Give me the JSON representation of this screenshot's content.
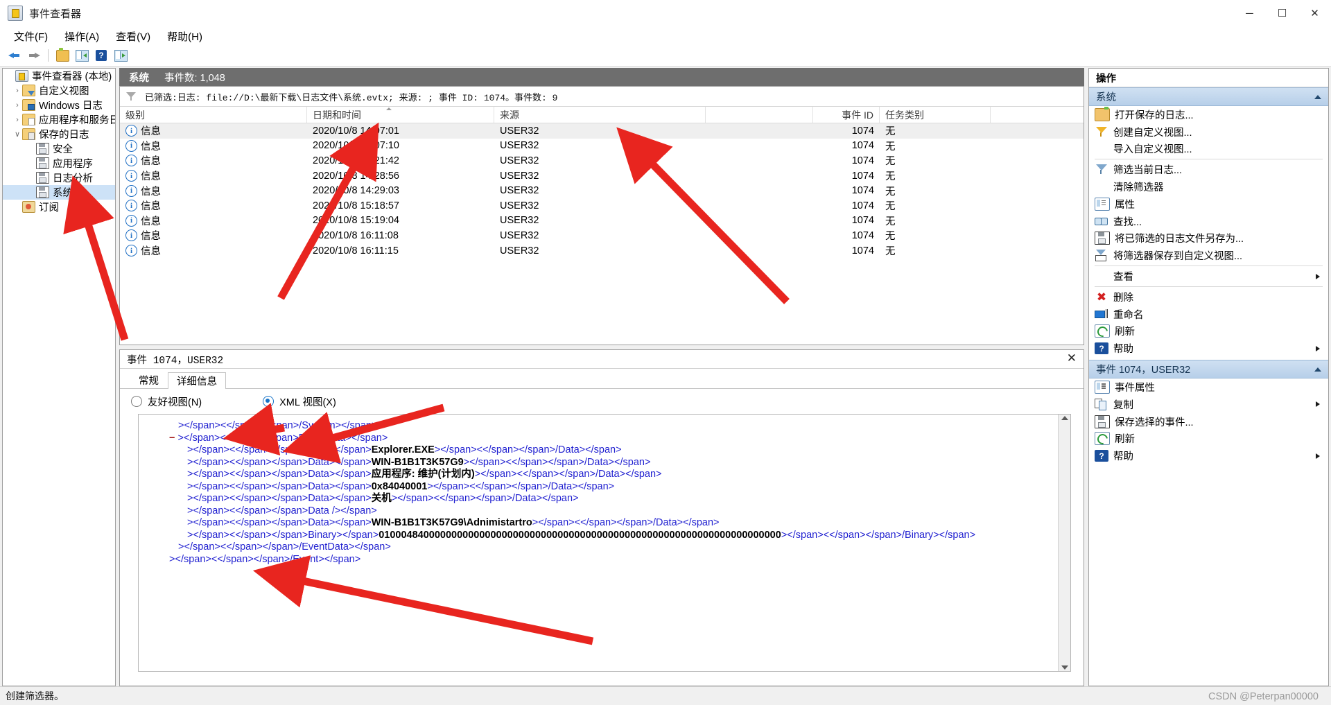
{
  "window": {
    "title": "事件查看器",
    "icon": "event-viewer-icon",
    "minimize": "─",
    "maximize": "☐",
    "close": "✕"
  },
  "menu": [
    {
      "label": "文件(F)"
    },
    {
      "label": "操作(A)"
    },
    {
      "label": "查看(V)"
    },
    {
      "label": "帮助(H)"
    }
  ],
  "toolbar": [
    {
      "name": "back",
      "icon": "arrow-left-icon"
    },
    {
      "name": "forward",
      "icon": "arrow-right-icon"
    },
    {
      "name": "show-hide-console-tree",
      "icon": "folder-icon"
    },
    {
      "name": "show-action-pane",
      "icon": "pane-left-icon"
    },
    {
      "name": "help",
      "icon": "help-icon"
    },
    {
      "name": "show-preview-pane",
      "icon": "pane-right-icon"
    }
  ],
  "tree": {
    "root": {
      "label": "事件查看器 (本地)",
      "icon": "event-viewer-icon"
    },
    "items": [
      {
        "label": "自定义视图",
        "icon": "folder-filter-icon",
        "chevron": "›",
        "level": 1,
        "selected": false
      },
      {
        "label": "Windows 日志",
        "icon": "folder-windows-icon",
        "chevron": "›",
        "level": 1,
        "selected": false
      },
      {
        "label": "应用程序和服务日志",
        "icon": "folder-doc-icon",
        "chevron": "›",
        "level": 1,
        "selected": false
      },
      {
        "label": "保存的日志",
        "icon": "folder-saved-icon",
        "chevron": "∨",
        "level": 1,
        "selected": false
      },
      {
        "label": "安全",
        "icon": "disk-icon",
        "chevron": "",
        "level": 2,
        "selected": false
      },
      {
        "label": "应用程序",
        "icon": "disk-icon",
        "chevron": "",
        "level": 2,
        "selected": false
      },
      {
        "label": "日志分析",
        "icon": "disk-icon",
        "chevron": "",
        "level": 2,
        "selected": false
      },
      {
        "label": "系统",
        "icon": "disk-icon",
        "chevron": "",
        "level": 2,
        "selected": true
      },
      {
        "label": "订阅",
        "icon": "subscription-icon",
        "chevron": "",
        "level": 1,
        "selected": false
      }
    ]
  },
  "log": {
    "name": "系统",
    "count_label": "事件数: 1,048",
    "filter_text": "已筛选:日志: file://D:\\最新下载\\日志文件\\系统.evtx; 来源: ; 事件 ID: 1074。事件数: 9",
    "filter_icon": "funnel-icon"
  },
  "table": {
    "columns": [
      "级别",
      "日期和时间",
      "来源",
      "",
      "事件 ID",
      "任务类别"
    ],
    "sort_column": "日期和时间",
    "rows": [
      {
        "level": "信息",
        "datetime": "2020/10/8 14:07:01",
        "source": "USER32",
        "event_id": "1074",
        "task": "无",
        "selected": true
      },
      {
        "level": "信息",
        "datetime": "2020/10/8 14:07:10",
        "source": "USER32",
        "event_id": "1074",
        "task": "无",
        "selected": false
      },
      {
        "level": "信息",
        "datetime": "2020/10/8 14:21:42",
        "source": "USER32",
        "event_id": "1074",
        "task": "无",
        "selected": false
      },
      {
        "level": "信息",
        "datetime": "2020/10/8 14:28:56",
        "source": "USER32",
        "event_id": "1074",
        "task": "无",
        "selected": false
      },
      {
        "level": "信息",
        "datetime": "2020/10/8 14:29:03",
        "source": "USER32",
        "event_id": "1074",
        "task": "无",
        "selected": false
      },
      {
        "level": "信息",
        "datetime": "2020/10/8 15:18:57",
        "source": "USER32",
        "event_id": "1074",
        "task": "无",
        "selected": false
      },
      {
        "level": "信息",
        "datetime": "2020/10/8 15:19:04",
        "source": "USER32",
        "event_id": "1074",
        "task": "无",
        "selected": false
      },
      {
        "level": "信息",
        "datetime": "2020/10/8 16:11:08",
        "source": "USER32",
        "event_id": "1074",
        "task": "无",
        "selected": false
      },
      {
        "level": "信息",
        "datetime": "2020/10/8 16:11:15",
        "source": "USER32",
        "event_id": "1074",
        "task": "无",
        "selected": false
      }
    ]
  },
  "detail": {
    "header": "事件 1074，USER32",
    "close": "✕",
    "tabs": [
      {
        "label": "常规",
        "active": false
      },
      {
        "label": "详细信息",
        "active": true
      }
    ],
    "view_options": [
      {
        "label": "友好视图(N)",
        "selected": false
      },
      {
        "label": "XML 视图(X)",
        "selected": true
      }
    ],
    "xml_lines": [
      {
        "indent": 3,
        "minus": false,
        "parts": [
          {
            "t": "tag",
            "v": "</System>"
          }
        ]
      },
      {
        "indent": 2,
        "minus": true,
        "parts": [
          {
            "t": "tag",
            "v": "<EventData>"
          }
        ]
      },
      {
        "indent": 4,
        "minus": false,
        "parts": [
          {
            "t": "tag",
            "v": "<Data>"
          },
          {
            "t": "val",
            "v": "Explorer.EXE"
          },
          {
            "t": "tag",
            "v": "</Data>"
          }
        ]
      },
      {
        "indent": 4,
        "minus": false,
        "parts": [
          {
            "t": "tag",
            "v": "<Data>"
          },
          {
            "t": "val",
            "v": "WIN-B1B1T3K57G9"
          },
          {
            "t": "tag",
            "v": "</Data>"
          }
        ]
      },
      {
        "indent": 4,
        "minus": false,
        "parts": [
          {
            "t": "tag",
            "v": "<Data>"
          },
          {
            "t": "val",
            "v": "应用程序: 维护(计划内)"
          },
          {
            "t": "tag",
            "v": "</Data>"
          }
        ]
      },
      {
        "indent": 4,
        "minus": false,
        "parts": [
          {
            "t": "tag",
            "v": "<Data>"
          },
          {
            "t": "val",
            "v": "0x84040001"
          },
          {
            "t": "tag",
            "v": "</Data>"
          }
        ]
      },
      {
        "indent": 4,
        "minus": false,
        "parts": [
          {
            "t": "tag",
            "v": "<Data>"
          },
          {
            "t": "val",
            "v": "关机"
          },
          {
            "t": "tag",
            "v": "</Data>"
          }
        ]
      },
      {
        "indent": 4,
        "minus": false,
        "parts": [
          {
            "t": "tag",
            "v": "<Data />"
          }
        ]
      },
      {
        "indent": 4,
        "minus": false,
        "parts": [
          {
            "t": "tag",
            "v": "<Data>"
          },
          {
            "t": "val",
            "v": "WIN-B1B1T3K57G9\\Adnimistartro"
          },
          {
            "t": "tag",
            "v": "</Data>"
          }
        ]
      },
      {
        "indent": 4,
        "minus": false,
        "parts": [
          {
            "t": "tag",
            "v": "<Binary>"
          },
          {
            "t": "val",
            "v": "010004840000000000000000000000000000000000000000000000000000000000000000"
          },
          {
            "t": "tag",
            "v": "</Binary>"
          }
        ]
      },
      {
        "indent": 3,
        "minus": false,
        "parts": [
          {
            "t": "tag",
            "v": "</EventData>"
          }
        ]
      },
      {
        "indent": 2,
        "minus": false,
        "parts": [
          {
            "t": "tag",
            "v": "</Event>"
          }
        ]
      }
    ]
  },
  "actions": {
    "title": "操作",
    "groups": [
      {
        "header": "系统",
        "collapse_icon": "caret-up-icon",
        "items": [
          {
            "label": "打开保存的日志...",
            "icon": "open-log-icon",
            "submenu": false,
            "indent": false
          },
          {
            "label": "创建自定义视图...",
            "icon": "funnel-yellow-icon",
            "submenu": false,
            "indent": false
          },
          {
            "label": "导入自定义视图...",
            "icon": "",
            "submenu": false,
            "indent": true
          },
          {
            "sep": true
          },
          {
            "label": "筛选当前日志...",
            "icon": "funnel-blue-icon",
            "submenu": false,
            "indent": false
          },
          {
            "label": "清除筛选器",
            "icon": "",
            "submenu": false,
            "indent": true
          },
          {
            "label": "属性",
            "icon": "properties-icon",
            "submenu": false,
            "indent": false
          },
          {
            "label": "查找...",
            "icon": "find-icon",
            "submenu": false,
            "indent": false
          },
          {
            "label": "将已筛选的日志文件另存为...",
            "icon": "save-icon",
            "submenu": false,
            "indent": false
          },
          {
            "label": "将筛选器保存到自定义视图...",
            "icon": "save-filter-icon",
            "submenu": false,
            "indent": false
          },
          {
            "sep": true
          },
          {
            "label": "查看",
            "icon": "",
            "submenu": true,
            "indent": true
          },
          {
            "sep": true
          },
          {
            "label": "删除",
            "icon": "delete-icon",
            "submenu": false,
            "indent": false
          },
          {
            "label": "重命名",
            "icon": "rename-icon",
            "submenu": false,
            "indent": false
          },
          {
            "label": "刷新",
            "icon": "refresh-icon",
            "submenu": false,
            "indent": false
          },
          {
            "label": "帮助",
            "icon": "help-icon",
            "submenu": true,
            "indent": false
          }
        ]
      },
      {
        "header": "事件 1074，USER32",
        "collapse_icon": "caret-up-icon",
        "items": [
          {
            "label": "事件属性",
            "icon": "properties-icon",
            "submenu": false,
            "indent": false
          },
          {
            "label": "复制",
            "icon": "copy-icon",
            "submenu": true,
            "indent": false
          },
          {
            "label": "保存选择的事件...",
            "icon": "save-icon",
            "submenu": false,
            "indent": false
          },
          {
            "label": "刷新",
            "icon": "refresh-icon",
            "submenu": false,
            "indent": false
          },
          {
            "label": "帮助",
            "icon": "help-icon",
            "submenu": true,
            "indent": false
          }
        ]
      }
    ]
  },
  "statusbar": {
    "text": "创建筛选器。"
  },
  "watermark": {
    "text": "CSDN @Peterpan00000"
  },
  "colors": {
    "accent": "#2a6fb5",
    "header_bg": "#6e6e6e",
    "selection": "#cde2f7",
    "annotation": "#e8251f",
    "xml_tag": "#a31515",
    "xml_bracket": "#1f1fd0"
  }
}
